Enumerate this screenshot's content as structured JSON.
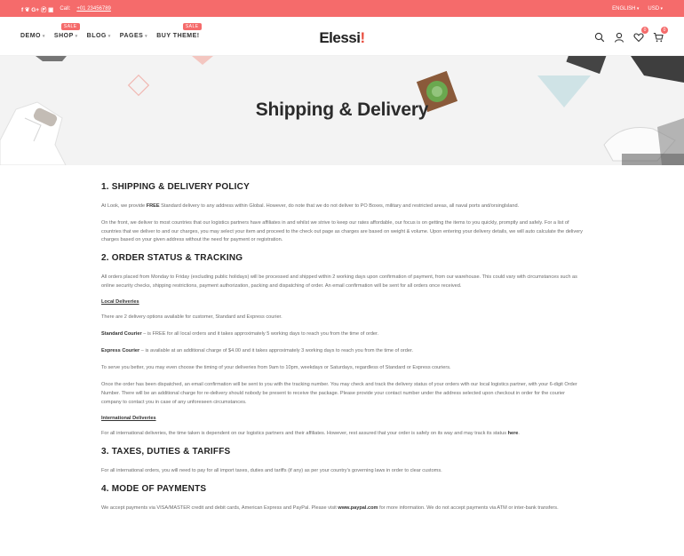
{
  "topbar": {
    "social_icons": [
      "facebook-icon",
      "twitter-icon",
      "google-plus-icon",
      "pinterest-icon",
      "instagram-icon"
    ],
    "social_glyphs": "f  ❦  G+  Ⓟ  ▣",
    "call_label": "Call:",
    "phone": "+01 23456789",
    "language": "ENGLISH",
    "currency": "USD"
  },
  "nav": {
    "items": [
      {
        "label": "DEMO",
        "badge": ""
      },
      {
        "label": "SHOP",
        "badge": "SALE"
      },
      {
        "label": "BLOG",
        "badge": ""
      },
      {
        "label": "PAGES",
        "badge": ""
      },
      {
        "label": "BUY THEME!",
        "badge": "SALE"
      }
    ]
  },
  "logo": {
    "text": "Elessi",
    "accent": "!"
  },
  "header_icons": {
    "wishlist_count": "0",
    "cart_count": "0"
  },
  "hero": {
    "title": "Shipping & Delivery"
  },
  "sections": {
    "s1": {
      "title": "1. SHIPPING & DELIVERY POLICY",
      "p1_a": "At Look, we provide ",
      "p1_b": "FREE",
      "p1_c": " Standard delivery to any address within Global. However, do note that we do not deliver to PO Boxes, military and restricted areas, all naval ports and/orsinglsland.",
      "p2": "On the front, we deliver to most countries that our logistics partners have affiliates in and whilst we strive to keep our rates affordable, our focus is on getting the items to you quickly, promptly and safely. For a list of countries that we deliver to and our charges, you may select your item and proceed to the check out page as charges are based on weight & volume. Upon entering your delivery details, we will auto calculate the delivery charges based on your given address without the need for payment or registration."
    },
    "s2": {
      "title": "2. ORDER STATUS & TRACKING",
      "p1": "All orders placed from Monday to Friday (excluding public holidays) will be processed and shipped within 2 working days upon confirmation of payment, from our warehouse. This could vary with circumstances such as online security checks, shipping restrictions, payment authorization, packing and dispatching of order. An email confirmation will be sent for all orders once received.",
      "local_heading": "Local Deliveries",
      "p2": "There are 2 delivery options available for customer, Standard and Express courier.",
      "standard_label": "Standard Courier",
      "standard_text": " – is FREE for all local orders and it takes approximately 5 working days to reach you from the time of order.",
      "express_label": "Express Courier",
      "express_text": " – is available at an additional charge of $4.00 and it takes approximately 3 working days to reach you from the time of order.",
      "p3": "To serve you better, you may even choose the timing of your deliveries from 9am to 10pm, weekdays or Saturdays, regardless of Standard or Express couriers.",
      "p4": "Once the order has been dispatched, an email confirmation will be sent to you with the tracking number. You may check and track the delivery status of your orders with our local logistics partner, with your 6-digit Order Number. There will be an additional charge for re-delivery should nobody be present to receive the package. Please provide your contact number under the address selected upon checkout in order for the courier company to contact you in case of any unforeseen circumstances.",
      "intl_heading": "International Deliveries",
      "p5_a": "For all international deliveries, the time taken is dependent on our logistics partners and their affiliates. However, rest assured that your order is safely on its way and may track its status ",
      "p5_link": "here",
      "p5_b": "."
    },
    "s3": {
      "title": "3. TAXES, DUTIES & TARIFFS",
      "p1": "For all international orders, you will need to pay for all import taxes, duties and tariffs (if any) as per your country's governing laws in order to clear customs."
    },
    "s4": {
      "title": "4. MODE OF PAYMENTS",
      "p1_a": "We accept payments via VISA/MASTER credit and debit cards, American Express and PayPal. Please visit ",
      "p1_link": "www.paypal.com",
      "p1_b": " for more information. We do not accept payments via ATM or inter-bank transfers."
    }
  },
  "colors": {
    "accent": "#f56b6b",
    "heading": "#222222",
    "text": "#6a6a6a"
  }
}
